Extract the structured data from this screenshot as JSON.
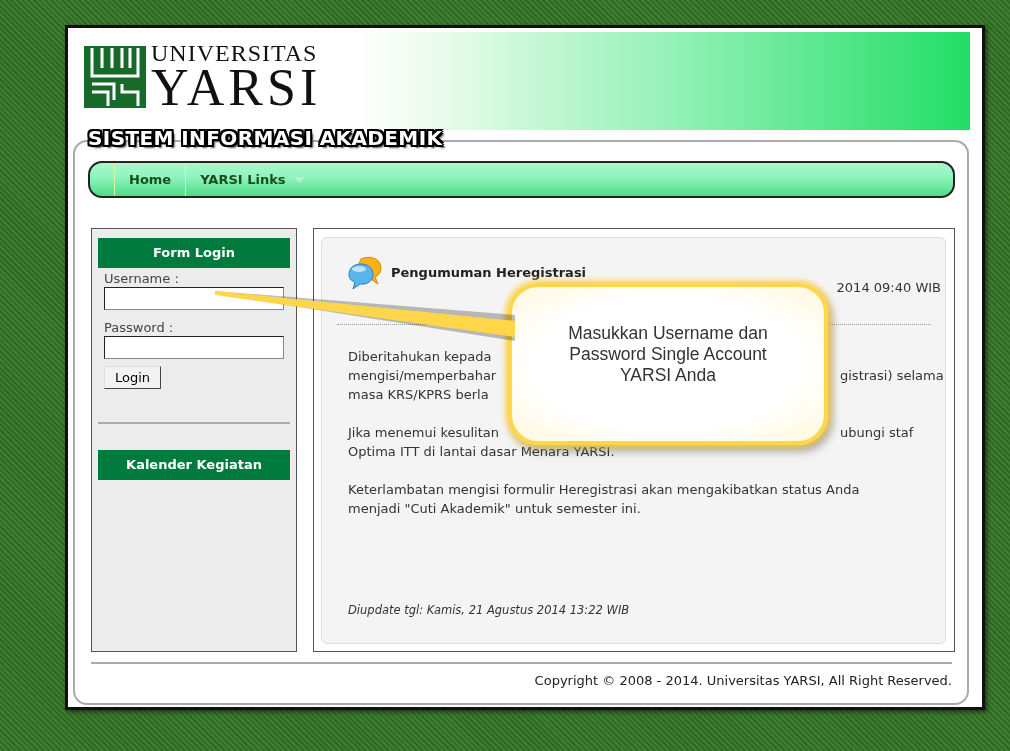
{
  "header": {
    "logo_line_1": "UNIVERSITAS",
    "logo_line_2": "YARSI",
    "system_title": "SISTEM INFORMASI AKADEMIK"
  },
  "nav": {
    "items": [
      {
        "label": "Home",
        "has_dropdown": false
      },
      {
        "label": "YARSI Links",
        "has_dropdown": true
      }
    ]
  },
  "sidebar": {
    "login_title": "Form Login",
    "username_label": "Username :",
    "password_label": "Password :",
    "login_button": "Login",
    "calendar_title": "Kalender Kegiatan"
  },
  "announcement": {
    "title": "Pengumuman Heregistrasi",
    "date": "2014 09:40 WIB",
    "paragraphs": [
      [
        {
          "left": "Diberitahukan kepada"
        },
        {
          "left": "mengisi/memperbahar",
          "right": "gistrasi) selama"
        },
        {
          "left": "masa KRS/KPRS berla"
        }
      ],
      [
        {
          "left": "Jika menemui kesulitan",
          "right": "ubungi staf"
        },
        {
          "left": "Optima ITT di lantai dasar Menara YARSI."
        }
      ],
      [
        {
          "left": "Keterlambatan mengisi formulir Heregistrasi akan mengakibatkan status Anda"
        },
        {
          "left": "menjadi \"Cuti Akademik\" untuk semester ini."
        }
      ]
    ],
    "updated": "Diupdate tgl: Kamis, 21 Agustus 2014 13:22 WIB"
  },
  "footer": {
    "copyright": "Copyright © 2008 - 2014. Universitas YARSI, All Right Reserved."
  },
  "callout": {
    "text": "Masukkan Username dan Password Single Account YARSI Anda"
  }
}
